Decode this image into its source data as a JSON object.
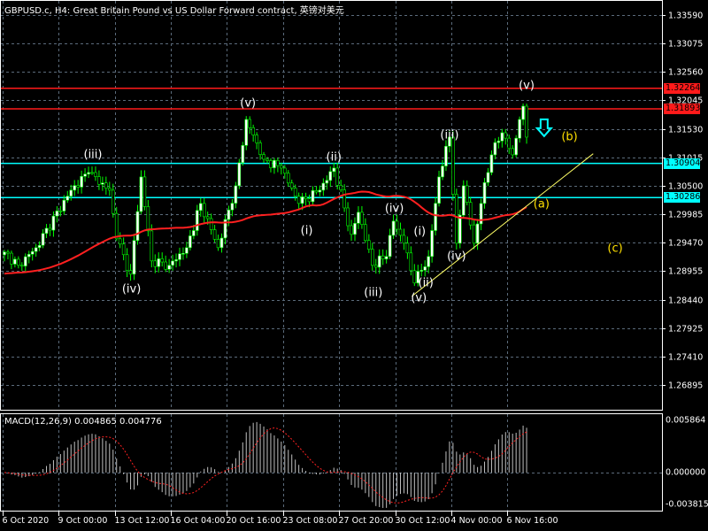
{
  "header": {
    "title": "GBPUSD.c, H4:  Great Britain Pound vs US Dollar Forward contract, 英镑对美元",
    "macd_title": "MACD(12,26,9) 0.004865 0.004776"
  },
  "colors": {
    "bg": "#000000",
    "grid": "#5b6b7b",
    "candle": "#00ff00",
    "ma": "#ff2020",
    "res": "#ff1a1a",
    "sup": "#00ffff",
    "trend": "#ffff66",
    "wave": "#ffffff",
    "abc": "#ffe000"
  },
  "chart_data": {
    "type": "candlestick",
    "symbol": "GBPUSD.c",
    "timeframe": "H4",
    "ylim": [
      1.2653,
      1.3378
    ],
    "y_ticks": [
      "1.33590",
      "1.33075",
      "1.32560",
      "1.32045",
      "1.31530",
      "1.31015",
      "1.30500",
      "1.29985",
      "1.29470",
      "1.28955",
      "1.28440",
      "1.27925",
      "1.27410",
      "1.26895"
    ],
    "x_ticks": [
      {
        "bar": 0,
        "label": "6 Oct 2020"
      },
      {
        "bar": 16,
        "label": "9 Oct 00:00"
      },
      {
        "bar": 32,
        "label": "13 Oct 12:00"
      },
      {
        "bar": 48,
        "label": "16 Oct 04:00"
      },
      {
        "bar": 64,
        "label": "20 Oct 16:00"
      },
      {
        "bar": 80,
        "label": "23 Oct 08:00"
      },
      {
        "bar": 96,
        "label": "27 Oct 20:00"
      },
      {
        "bar": 112,
        "label": "30 Oct 12:00"
      },
      {
        "bar": 128,
        "label": "4 Nov 00:00"
      },
      {
        "bar": 144,
        "label": "6 Nov 16:00"
      }
    ],
    "bars": 150,
    "close_anchors": [
      [
        0,
        1.293
      ],
      [
        4,
        1.2906
      ],
      [
        9,
        1.2938
      ],
      [
        19,
        1.3042
      ],
      [
        24,
        1.3074
      ],
      [
        30,
        1.3042
      ],
      [
        32,
        1.2954
      ],
      [
        36,
        1.289
      ],
      [
        39,
        1.3066
      ],
      [
        42,
        1.2914
      ],
      [
        47,
        1.2906
      ],
      [
        52,
        1.2938
      ],
      [
        56,
        1.3018
      ],
      [
        61,
        1.2938
      ],
      [
        66,
        1.305
      ],
      [
        69,
        1.317
      ],
      [
        74,
        1.3098
      ],
      [
        79,
        1.3082
      ],
      [
        84,
        1.3018
      ],
      [
        90,
        1.3042
      ],
      [
        94,
        1.3082
      ],
      [
        99,
        1.2962
      ],
      [
        101,
        1.3002
      ],
      [
        105,
        1.2906
      ],
      [
        109,
        1.2922
      ],
      [
        111,
        1.2986
      ],
      [
        114,
        1.2946
      ],
      [
        117,
        1.2874
      ],
      [
        121,
        1.2922
      ],
      [
        124,
        1.3066
      ],
      [
        127,
        1.3138
      ],
      [
        129,
        1.2946
      ],
      [
        131,
        1.305
      ],
      [
        134,
        1.2946
      ],
      [
        136,
        1.3018
      ],
      [
        139,
        1.3106
      ],
      [
        142,
        1.3146
      ],
      [
        145,
        1.3106
      ],
      [
        147,
        1.317
      ],
      [
        148,
        1.3194
      ],
      [
        149,
        1.3138
      ]
    ],
    "moving_average_period": 50,
    "hlines": [
      {
        "price": 1.32264,
        "label": "1.32264",
        "kind": "res"
      },
      {
        "price": 1.31893,
        "label": "1.31893",
        "kind": "res"
      },
      {
        "price": 1.30904,
        "label": "1.30904",
        "kind": "sup"
      },
      {
        "price": 1.30286,
        "label": "1.30286",
        "kind": "sup"
      }
    ],
    "trendline": {
      "from": [
        116.25,
        1.285
      ],
      "to": [
        168,
        1.3108
      ]
    },
    "wave_labels": [
      {
        "text": "(iii)",
        "bar": 25.25,
        "price": 1.3106,
        "kind": "wave"
      },
      {
        "text": "(iv)",
        "bar": 36.25,
        "price": 1.2862,
        "kind": "wave"
      },
      {
        "text": "(v)",
        "bar": 69.5,
        "price": 1.3199,
        "kind": "wave"
      },
      {
        "text": "(ii)",
        "bar": 94,
        "price": 1.3101,
        "kind": "wave"
      },
      {
        "text": "(i)",
        "bar": 86.25,
        "price": 1.2968,
        "kind": "wave"
      },
      {
        "text": "(iv)",
        "bar": 111.25,
        "price": 1.3008,
        "kind": "wave"
      },
      {
        "text": "(iii)",
        "bar": 105.25,
        "price": 1.2856,
        "kind": "wave"
      },
      {
        "text": "(i)",
        "bar": 118.5,
        "price": 1.2966,
        "kind": "wave"
      },
      {
        "text": "(ii)",
        "bar": 120.25,
        "price": 1.2874,
        "kind": "wave"
      },
      {
        "text": "(v)",
        "bar": 118.25,
        "price": 1.2846,
        "kind": "wave"
      },
      {
        "text": "(iv)",
        "bar": 129,
        "price": 1.2922,
        "kind": "wave"
      },
      {
        "text": "(iii)",
        "bar": 127,
        "price": 1.3141,
        "kind": "wave"
      },
      {
        "text": "(v)",
        "bar": 149,
        "price": 1.3231,
        "kind": "wave"
      },
      {
        "text": "(b)",
        "bar": 161.25,
        "price": 1.3138,
        "kind": "abc"
      },
      {
        "text": "(a)",
        "bar": 153.25,
        "price": 1.3016,
        "kind": "abc"
      },
      {
        "text": "(c)",
        "bar": 174.25,
        "price": 1.2936,
        "kind": "abc"
      }
    ],
    "arrow": {
      "bar": 154,
      "price": 1.3151,
      "direction": "down"
    },
    "macd": {
      "params": "12,26,9",
      "value": 0.004865,
      "signal": 0.004776,
      "y_ticks": [
        "0.005864",
        "0.000000",
        "-0.003815"
      ],
      "ylim": [
        -0.003815,
        0.005864
      ]
    }
  }
}
